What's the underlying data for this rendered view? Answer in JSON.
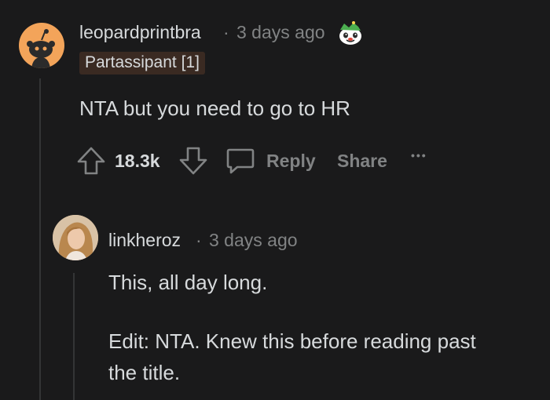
{
  "comment": {
    "username": "leopardprintbra",
    "separator": "·",
    "time": "3 days ago",
    "flair": "Partassipant [1]",
    "body": "NTA but you need to go to HR",
    "score": "18.3k",
    "reply_label": "Reply",
    "share_label": "Share",
    "more_label": "•••",
    "avatar_icon": "reddit-snoo-icon",
    "award_icon": "snoo-award-icon"
  },
  "reply": {
    "username": "linkheroz",
    "separator": "·",
    "time": "3 days ago",
    "body_line1": "This, all day long.",
    "body_line2": "Edit: NTA. Knew this before reading past",
    "body_line3": "the title."
  },
  "colors": {
    "background": "#1a1a1b",
    "text": "#d7dadc",
    "muted": "#818384",
    "flair_bg": "#3a2a22",
    "avatar_orange": "#f3a45a"
  }
}
